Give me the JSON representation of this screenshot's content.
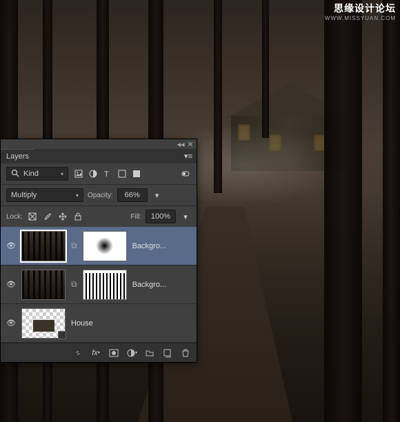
{
  "watermark": {
    "text1": "思缘设计论坛",
    "text2": "WWW.MISSYUAN.COM"
  },
  "panel": {
    "title": "Layers",
    "filter": {
      "label": "Kind"
    },
    "blend_mode": "Multiply",
    "opacity": {
      "label": "Opacity:",
      "value": "66%"
    },
    "lock": {
      "label": "Lock:"
    },
    "fill": {
      "label": "Fill:",
      "value": "100%"
    },
    "layers": [
      {
        "name": "Backgro...",
        "visible": true,
        "selected": true,
        "has_mask": true
      },
      {
        "name": "Backgro...",
        "visible": true,
        "selected": false,
        "has_mask": true
      },
      {
        "name": "House",
        "visible": true,
        "selected": false,
        "has_mask": false
      }
    ]
  }
}
